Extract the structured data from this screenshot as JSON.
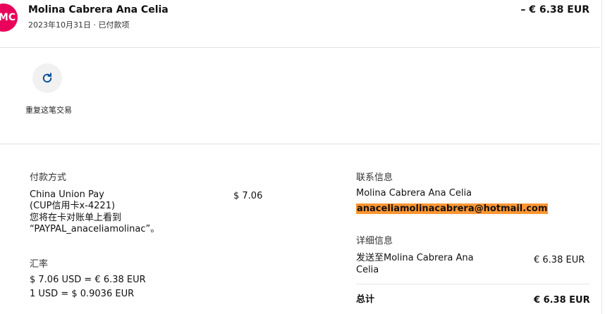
{
  "header": {
    "avatar_initials": "MC",
    "name": "Molina Cabrera Ana Celia",
    "subtitle": "2023年10月31日 · 已付款项",
    "amount": "– € 6.38 EUR"
  },
  "actions": {
    "repeat_label": "重复这笔交易"
  },
  "payment": {
    "title": "付款方式",
    "method_line1": "China Union Pay",
    "method_line2": "(CUP信用卡x-4221)",
    "method_line3": "您将在卡对账单上看到",
    "method_line4": "“PAYPAL_anaceliamolinac”。",
    "amount": "$ 7.06"
  },
  "exchange": {
    "title": "汇率",
    "line1": "$ 7.06 USD = € 6.38 EUR",
    "line2": "1 USD = $ 0.9036 EUR"
  },
  "contact": {
    "title": "联系信息",
    "name": "Molina Cabrera Ana Celia",
    "email": "anaceliamolinacabrera@hotmail.com"
  },
  "details": {
    "title": "详细信息",
    "sent_to_line1": "发送至Molina Cabrera Ana",
    "sent_to_line2": "Celia",
    "sent_amount": "€ 6.38 EUR",
    "total_label": "总计",
    "total_amount": "€ 6.38 EUR"
  },
  "colors": {
    "avatar_bg": "#e8005a",
    "email_highlight": "#ff9632",
    "icon_blue": "#0b4f9c"
  },
  "icons": {
    "repeat": "refresh-icon"
  }
}
